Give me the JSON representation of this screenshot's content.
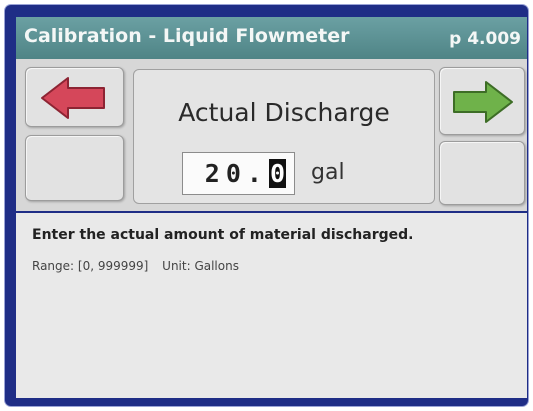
{
  "header": {
    "title": "Calibration - Liquid Flowmeter",
    "page": "p 4.009"
  },
  "field": {
    "title": "Actual Discharge",
    "value_prefix": "20.",
    "cursor_digit": "0",
    "unit": "gal"
  },
  "info": {
    "instructions": "Enter the actual amount of material discharged.",
    "range": "Range: [0, 999999]",
    "unit": "Unit: Gallons"
  },
  "icons": {
    "back": "left-arrow-icon",
    "next": "right-arrow-icon"
  },
  "colors": {
    "frame": "#1f2d86",
    "title_bar": "#5b9093",
    "back_arrow": "#d5475a",
    "next_arrow": "#6fb24a"
  }
}
